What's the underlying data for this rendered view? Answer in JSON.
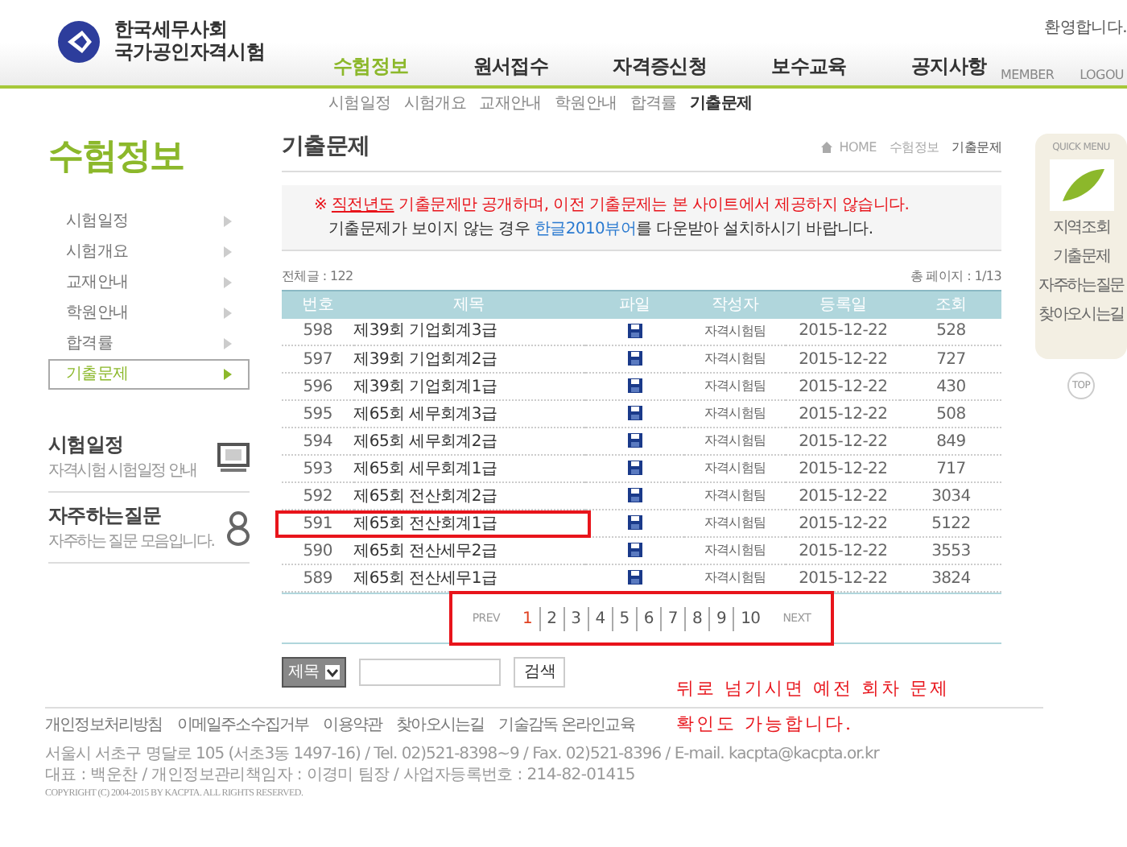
{
  "header": {
    "logo_lines": [
      "한국세무사회",
      "국가공인자격시험"
    ],
    "welcome": "환영합니다.",
    "util_links": [
      "MEMBER",
      "LOGOU"
    ]
  },
  "main_nav": [
    {
      "label": "수험정보",
      "selected": true
    },
    {
      "label": "원서접수",
      "selected": false
    },
    {
      "label": "자격증신청",
      "selected": false
    },
    {
      "label": "보수교육",
      "selected": false
    },
    {
      "label": "공지사항",
      "selected": false
    }
  ],
  "sub_nav": [
    {
      "label": "시험일정",
      "selected": false
    },
    {
      "label": "시험개요",
      "selected": false
    },
    {
      "label": "교재안내",
      "selected": false
    },
    {
      "label": "학원안내",
      "selected": false
    },
    {
      "label": "합격률",
      "selected": false
    },
    {
      "label": "기출문제",
      "selected": true
    }
  ],
  "sidebar": {
    "title": "수험정보",
    "items": [
      {
        "label": "시험일정",
        "selected": false
      },
      {
        "label": "시험개요",
        "selected": false
      },
      {
        "label": "교재안내",
        "selected": false
      },
      {
        "label": "학원안내",
        "selected": false
      },
      {
        "label": "합격률",
        "selected": false
      },
      {
        "label": "기출문제",
        "selected": true
      }
    ],
    "promos": [
      {
        "kind": "monitor",
        "title": "시험일정",
        "subtitle": "자격시험 시험일정 안내"
      },
      {
        "kind": "person",
        "title": "자주하는질문",
        "subtitle": "자주하는 질문 모음입니다."
      }
    ]
  },
  "content": {
    "title": "기출문제",
    "breadcrumb": [
      "HOME",
      "수험정보",
      "기출문제"
    ],
    "notice": {
      "mark": "※",
      "emphasis": "직전년도",
      "text": " 기출문제만 공개하며, 이전 기출문제는 본 사이트에서 제공하지 않습니다.",
      "before_link": "기출문제가 보이지 않는 경우 ",
      "link": "한글2010뷰어",
      "after_link": "를 다운받아 설치하시기 바랍니다."
    },
    "total": "전체글 : 122",
    "page_count": "총 페이지 : 1/13",
    "table": {
      "columns": [
        "번호",
        "제목",
        "파일",
        "작성자",
        "등록일",
        "조회"
      ],
      "rows": [
        {
          "no": "598",
          "title": "제39회 기업회계3급",
          "author": "자격시험팀",
          "date": "2015-12-22",
          "views": "528",
          "highlighted": false
        },
        {
          "no": "597",
          "title": "제39회 기업회계2급",
          "author": "자격시험팀",
          "date": "2015-12-22",
          "views": "727",
          "highlighted": false
        },
        {
          "no": "596",
          "title": "제39회 기업회계1급",
          "author": "자격시험팀",
          "date": "2015-12-22",
          "views": "430",
          "highlighted": false
        },
        {
          "no": "595",
          "title": "제65회 세무회계3급",
          "author": "자격시험팀",
          "date": "2015-12-22",
          "views": "508",
          "highlighted": false
        },
        {
          "no": "594",
          "title": "제65회 세무회계2급",
          "author": "자격시험팀",
          "date": "2015-12-22",
          "views": "849",
          "highlighted": false
        },
        {
          "no": "593",
          "title": "제65회 세무회계1급",
          "author": "자격시험팀",
          "date": "2015-12-22",
          "views": "717",
          "highlighted": false
        },
        {
          "no": "592",
          "title": "제65회 전산회계2급",
          "author": "자격시험팀",
          "date": "2015-12-22",
          "views": "3034",
          "highlighted": false
        },
        {
          "no": "591",
          "title": "제65회 전산회계1급",
          "author": "자격시험팀",
          "date": "2015-12-22",
          "views": "5122",
          "highlighted": true
        },
        {
          "no": "590",
          "title": "제65회 전산세무2급",
          "author": "자격시험팀",
          "date": "2015-12-22",
          "views": "3553",
          "highlighted": false
        },
        {
          "no": "589",
          "title": "제65회 전산세무1급",
          "author": "자격시험팀",
          "date": "2015-12-22",
          "views": "3824",
          "highlighted": false
        }
      ]
    },
    "pagination": {
      "highlighted": true,
      "prev": "PREV",
      "next": "NEXT",
      "pages": [
        {
          "label": "1",
          "selected": true
        },
        {
          "label": "2",
          "selected": false
        },
        {
          "label": "3",
          "selected": false
        },
        {
          "label": "4",
          "selected": false
        },
        {
          "label": "5",
          "selected": false
        },
        {
          "label": "6",
          "selected": false
        },
        {
          "label": "7",
          "selected": false
        },
        {
          "label": "8",
          "selected": false
        },
        {
          "label": "9",
          "selected": false
        },
        {
          "label": "10",
          "selected": false
        }
      ]
    },
    "search": {
      "field_select": "제목",
      "button": "검색"
    },
    "handwritten_note": [
      "뒤로 넘기시면 예전 회차 문제",
      "확인도 가능합니다."
    ]
  },
  "quick_menu": {
    "title": "QUICK MENU",
    "items": [
      "지역조회",
      "기출문제",
      "자주하는질문",
      "찾아오시는길"
    ],
    "top": "TOP"
  },
  "footer": {
    "links": [
      "개인정보처리방침",
      "이메일주소수집거부",
      "이용약관",
      "찾아오시는길",
      "기술감독 온라인교육"
    ],
    "address": "서울시 서초구 명달로 105 (서초3동 1497-16) / Tel. 02)521-8398~9 / Fax. 02)521-8396 / E-mail. kacpta@kacpta.or.kr",
    "info": "대표 : 백운찬 / 개인정보관리책임자 : 이경미 팀장 / 사업자등록번호 : 214-82-01415",
    "copyright": "COPYRIGHT (C) 2004-2015 BY KACPTA. ALL RIGHTS RESERVED."
  }
}
